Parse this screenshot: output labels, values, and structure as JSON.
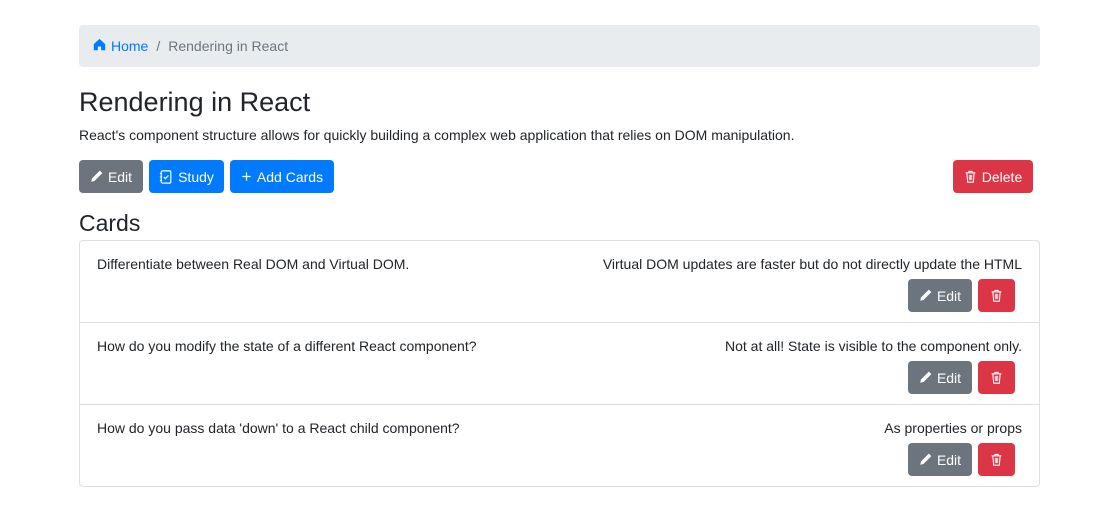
{
  "breadcrumb": {
    "home_label": "Home",
    "separator": "/",
    "current": "Rendering in React"
  },
  "deck": {
    "title": "Rendering in React",
    "description": "React's component structure allows for quickly building a complex web application that relies on DOM manipulation."
  },
  "toolbar": {
    "edit_label": "Edit",
    "study_label": "Study",
    "add_cards_label": "Add Cards",
    "delete_label": "Delete"
  },
  "cards_heading": "Cards",
  "cards": [
    {
      "front": "Differentiate between Real DOM and Virtual DOM.",
      "back": "Virtual DOM updates are faster but do not directly update the HTML",
      "edit_label": "Edit"
    },
    {
      "front": "How do you modify the state of a different React component?",
      "back": "Not at all! State is visible to the component only.",
      "edit_label": "Edit"
    },
    {
      "front": "How do you pass data 'down' to a React child component?",
      "back": "As properties or props",
      "edit_label": "Edit"
    }
  ],
  "colors": {
    "primary": "#007bff",
    "secondary": "#6c757d",
    "danger": "#dc3545",
    "breadcrumb_bg": "#e9ecef"
  },
  "icons": {
    "home": "house-icon",
    "edit": "pencil-icon",
    "study": "journal-check-icon",
    "add": "plus-icon",
    "delete": "trash-icon"
  }
}
